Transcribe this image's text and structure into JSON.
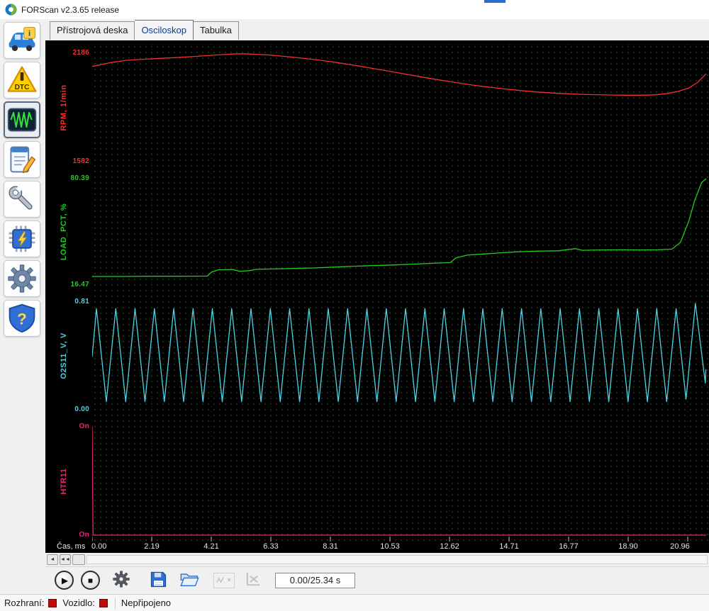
{
  "window": {
    "title": "FORScan v2.3.65 release"
  },
  "tabs": {
    "items": [
      {
        "label": "Přístrojová deska"
      },
      {
        "label": "Osciloskop"
      },
      {
        "label": "Tabulka"
      }
    ],
    "active_index": 1
  },
  "sidebar": {
    "items": [
      "vehicle-info",
      "dtc",
      "oscilloscope",
      "table-check",
      "service-functions",
      "configuration",
      "settings",
      "help"
    ],
    "dtc_label": "DTC",
    "help_glyph": "?"
  },
  "chart_data": {
    "type": "line",
    "title": "",
    "xlabel": "Čas, ms",
    "x_ticks": [
      "0.00",
      "2.19",
      "4.21",
      "6.33",
      "8.31",
      "10.53",
      "12.62",
      "14.71",
      "16.77",
      "18.90",
      "20.96"
    ],
    "grid": "dotted",
    "background": "#000000",
    "series": [
      {
        "name": "RPM, 1/min",
        "color": "#f43030",
        "min": 1582,
        "max": 2186,
        "min_label": "1582",
        "max_label": "2186",
        "points": [
          [
            0,
            2112
          ],
          [
            0.6,
            2132
          ],
          [
            1.2,
            2146
          ],
          [
            1.8,
            2152
          ],
          [
            2.4,
            2157
          ],
          [
            3,
            2162
          ],
          [
            3.6,
            2168
          ],
          [
            4.2,
            2174
          ],
          [
            4.8,
            2180
          ],
          [
            5.2,
            2183
          ],
          [
            5.6,
            2181
          ],
          [
            6.2,
            2176
          ],
          [
            6.8,
            2168
          ],
          [
            7.4,
            2158
          ],
          [
            8,
            2147
          ],
          [
            8.6,
            2134
          ],
          [
            9.2,
            2119
          ],
          [
            9.8,
            2103
          ],
          [
            10.4,
            2087
          ],
          [
            11,
            2070
          ],
          [
            11.6,
            2053
          ],
          [
            12.2,
            2037
          ],
          [
            12.8,
            2022
          ],
          [
            13.4,
            2008
          ],
          [
            14,
            1996
          ],
          [
            14.6,
            1985
          ],
          [
            15.2,
            1976
          ],
          [
            15.8,
            1968
          ],
          [
            16.4,
            1962
          ],
          [
            17,
            1958
          ],
          [
            17.6,
            1955
          ],
          [
            18.2,
            1953
          ],
          [
            18.8,
            1952
          ],
          [
            19.4,
            1952
          ],
          [
            19.8,
            1954
          ],
          [
            20.2,
            1960
          ],
          [
            20.6,
            1972
          ],
          [
            21,
            1992
          ],
          [
            21.3,
            2022
          ],
          [
            21.6,
            2070
          ]
        ]
      },
      {
        "name": "LOAD_PCT, %",
        "color": "#22cc22",
        "min": 16.47,
        "max": 80.39,
        "min_label": "16.47",
        "max_label": "80.39",
        "points": [
          [
            0,
            21.6
          ],
          [
            1,
            21.6
          ],
          [
            2,
            21.7
          ],
          [
            3,
            21.7
          ],
          [
            4.05,
            21.8
          ],
          [
            4.2,
            24.2
          ],
          [
            4.45,
            25.6
          ],
          [
            4.95,
            25.7
          ],
          [
            5.2,
            24.6
          ],
          [
            5.55,
            25.1
          ],
          [
            5.8,
            25.9
          ],
          [
            6.4,
            26.1
          ],
          [
            7.1,
            26.4
          ],
          [
            7.8,
            26.7
          ],
          [
            8.5,
            27.2
          ],
          [
            9.2,
            27.7
          ],
          [
            9.9,
            28.1
          ],
          [
            10.6,
            28.5
          ],
          [
            11.3,
            29
          ],
          [
            12,
            29.5
          ],
          [
            12.6,
            29.9
          ],
          [
            12.8,
            32.7
          ],
          [
            13.2,
            34.4
          ],
          [
            13.8,
            35.1
          ],
          [
            14.4,
            35.8
          ],
          [
            15,
            36.4
          ],
          [
            15.7,
            36.8
          ],
          [
            16.4,
            37
          ],
          [
            17,
            38.3
          ],
          [
            17.25,
            37.3
          ],
          [
            17.9,
            37.5
          ],
          [
            18.6,
            37.6
          ],
          [
            19.3,
            37.5
          ],
          [
            19.9,
            37.6
          ],
          [
            20.4,
            38
          ],
          [
            20.7,
            42
          ],
          [
            21,
            55
          ],
          [
            21.2,
            67
          ],
          [
            21.45,
            78
          ],
          [
            21.6,
            80.2
          ]
        ]
      },
      {
        "name": "O2S11_V, V",
        "color": "#4fd2e2",
        "min": 0,
        "max": 0.81,
        "min_label": "0.00",
        "max_label": "0.81",
        "points": [
          [
            0,
            0.4
          ],
          [
            0.15,
            0.76
          ],
          [
            0.5,
            0.06
          ],
          [
            0.83,
            0.76
          ],
          [
            1.18,
            0.06
          ],
          [
            1.51,
            0.76
          ],
          [
            1.86,
            0.06
          ],
          [
            2.19,
            0.76
          ],
          [
            2.54,
            0.06
          ],
          [
            2.87,
            0.76
          ],
          [
            3.22,
            0.06
          ],
          [
            3.55,
            0.76
          ],
          [
            3.9,
            0.06
          ],
          [
            4.23,
            0.76
          ],
          [
            4.58,
            0.06
          ],
          [
            4.91,
            0.76
          ],
          [
            5.26,
            0.06
          ],
          [
            5.59,
            0.76
          ],
          [
            5.94,
            0.06
          ],
          [
            6.27,
            0.76
          ],
          [
            6.62,
            0.06
          ],
          [
            6.95,
            0.76
          ],
          [
            7.3,
            0.06
          ],
          [
            7.63,
            0.76
          ],
          [
            7.98,
            0.06
          ],
          [
            8.31,
            0.76
          ],
          [
            8.66,
            0.06
          ],
          [
            8.99,
            0.76
          ],
          [
            9.34,
            0.06
          ],
          [
            9.67,
            0.76
          ],
          [
            10.02,
            0.06
          ],
          [
            10.35,
            0.76
          ],
          [
            10.7,
            0.06
          ],
          [
            11.03,
            0.76
          ],
          [
            11.38,
            0.06
          ],
          [
            11.71,
            0.76
          ],
          [
            12.06,
            0.06
          ],
          [
            12.39,
            0.76
          ],
          [
            12.74,
            0.06
          ],
          [
            13.07,
            0.76
          ],
          [
            13.42,
            0.06
          ],
          [
            13.75,
            0.76
          ],
          [
            14.1,
            0.06
          ],
          [
            14.43,
            0.76
          ],
          [
            14.78,
            0.06
          ],
          [
            15.11,
            0.76
          ],
          [
            15.46,
            0.06
          ],
          [
            15.79,
            0.76
          ],
          [
            16.14,
            0.06
          ],
          [
            16.47,
            0.76
          ],
          [
            16.82,
            0.06
          ],
          [
            17.15,
            0.76
          ],
          [
            17.5,
            0.06
          ],
          [
            17.83,
            0.76
          ],
          [
            18.18,
            0.06
          ],
          [
            18.51,
            0.76
          ],
          [
            18.86,
            0.06
          ],
          [
            19.19,
            0.76
          ],
          [
            19.54,
            0.06
          ],
          [
            19.87,
            0.76
          ],
          [
            20.22,
            0.06
          ],
          [
            20.55,
            0.76
          ],
          [
            20.9,
            0.08
          ],
          [
            21.23,
            0.8
          ],
          [
            21.58,
            0.2
          ],
          [
            21.6,
            0.3
          ]
        ]
      },
      {
        "name": "HTR11",
        "color": "#ee2277",
        "min": 0,
        "max": 1,
        "min_label": "On",
        "max_label": "On",
        "points": [
          [
            0,
            1
          ],
          [
            0.03,
            0
          ],
          [
            21.6,
            0
          ]
        ]
      }
    ]
  },
  "scrollbar": {
    "step_left_glyph": "◄",
    "jump_start_glyph": "◄◄"
  },
  "toolbar": {
    "play_glyph": "▶",
    "stop_glyph": "■",
    "combo_arrow": "▼",
    "time_display": "0.00/25.34 s"
  },
  "statusbar": {
    "interface_label": "Rozhraní:",
    "vehicle_label": "Vozidlo:",
    "status_text": "Nepřipojeno"
  }
}
